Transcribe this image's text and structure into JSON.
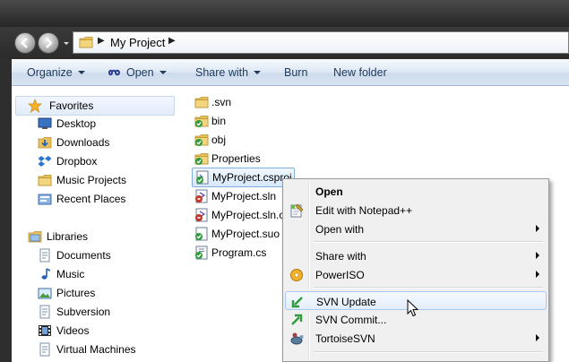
{
  "window": {
    "address_path": "My Project"
  },
  "toolbar": {
    "organize": "Organize",
    "open": "Open",
    "share_with": "Share with",
    "burn": "Burn",
    "new_folder": "New folder"
  },
  "navpane": {
    "favorites_header": "Favorites",
    "favorites": [
      "Desktop",
      "Downloads",
      "Dropbox",
      "Music Projects",
      "Recent Places"
    ],
    "libraries_header": "Libraries",
    "libraries": [
      "Documents",
      "Music",
      "Pictures",
      "Subversion",
      "Videos",
      "Virtual Machines"
    ]
  },
  "files": [
    {
      "name": ".svn",
      "type": "folder-plain"
    },
    {
      "name": "bin",
      "type": "folder-svn"
    },
    {
      "name": "obj",
      "type": "folder-svn"
    },
    {
      "name": "Properties",
      "type": "folder-svn"
    },
    {
      "name": "MyProject.csproj",
      "type": "file-svn-ok",
      "selected": true
    },
    {
      "name": "MyProject.sln",
      "type": "file-svn-mod"
    },
    {
      "name": "MyProject.sln.c",
      "type": "file-svn-mod"
    },
    {
      "name": "MyProject.suo",
      "type": "file-svn-ok"
    },
    {
      "name": "Program.cs",
      "type": "file-svn-ok"
    }
  ],
  "context_menu": {
    "open": "Open",
    "edit_notepad": "Edit with Notepad++",
    "open_with": "Open with",
    "share_with": "Share with",
    "poweriso": "PowerISO",
    "svn_update": "SVN Update",
    "svn_commit": "SVN Commit...",
    "tortoisesvn": "TortoiseSVN"
  },
  "colors": {
    "toolbar_text": "#1e395b",
    "selection_border": "#84acdd",
    "svn_green": "#2e9c3a",
    "svn_red": "#c0392b",
    "folder_yellow": "#e8c15a"
  }
}
